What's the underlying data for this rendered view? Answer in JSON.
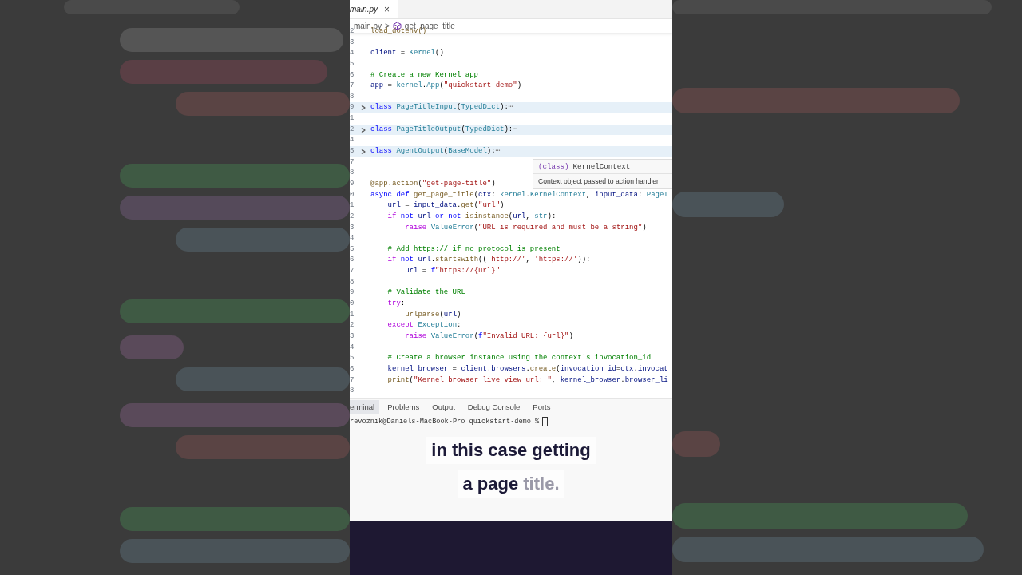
{
  "editor_tab": {
    "label": "main.py",
    "selected": true,
    "close": "×"
  },
  "breadcrumb": {
    "file": "main.py",
    "separator": ">",
    "symbol": "get_page_title"
  },
  "lines": [
    {
      "number": "2",
      "collapsed": false,
      "tokens": [
        {
          "text": "load_dotenv()",
          "kind": "fn"
        }
      ]
    },
    {
      "number": "3",
      "collapsed": false
    },
    {
      "number": "4",
      "collapsed": false,
      "tokens": [
        {
          "text": "client",
          "kind": "var"
        },
        {
          "text": " = ",
          "kind": "plain"
        },
        {
          "text": "Kernel",
          "kind": "cls"
        },
        {
          "text": "()",
          "kind": "plain"
        }
      ]
    },
    {
      "number": "5",
      "collapsed": false
    },
    {
      "number": "6",
      "collapsed": false,
      "tokens": [
        {
          "text": "# Create a new Kernel app",
          "kind": "com"
        }
      ]
    },
    {
      "number": "7",
      "collapsed": false,
      "tokens": [
        {
          "text": "app",
          "kind": "var"
        },
        {
          "text": " = ",
          "kind": "plain"
        },
        {
          "text": "kernel",
          "kind": "cls"
        },
        {
          "text": ".",
          "kind": "plain"
        },
        {
          "text": "App",
          "kind": "cls"
        },
        {
          "text": "(",
          "kind": "plain"
        },
        {
          "text": "\"quickstart-demo\"",
          "kind": "str"
        },
        {
          "text": ")",
          "kind": "plain"
        }
      ]
    },
    {
      "number": "8",
      "collapsed": false
    },
    {
      "number": "9",
      "collapsed": true,
      "tokens": [
        {
          "text": "class ",
          "kind": "kw"
        },
        {
          "text": "PageTitleInput",
          "kind": "cls"
        },
        {
          "text": "(",
          "kind": "plain"
        },
        {
          "text": "TypedDict",
          "kind": "cls"
        },
        {
          "text": "):",
          "kind": "plain"
        },
        {
          "text": "⋯",
          "kind": "fold"
        }
      ]
    },
    {
      "number": "1",
      "collapsed": false
    },
    {
      "number": "2",
      "collapsed": true,
      "tokens": [
        {
          "text": "class ",
          "kind": "kw"
        },
        {
          "text": "PageTitleOutput",
          "kind": "cls"
        },
        {
          "text": "(",
          "kind": "plain"
        },
        {
          "text": "TypedDict",
          "kind": "cls"
        },
        {
          "text": "):",
          "kind": "plain"
        },
        {
          "text": "⋯",
          "kind": "fold"
        }
      ]
    },
    {
      "number": "4",
      "collapsed": false
    },
    {
      "number": "5",
      "collapsed": true,
      "tokens": [
        {
          "text": "class ",
          "kind": "kw"
        },
        {
          "text": "AgentOutput",
          "kind": "cls"
        },
        {
          "text": "(",
          "kind": "plain"
        },
        {
          "text": "BaseModel",
          "kind": "cls"
        },
        {
          "text": "):",
          "kind": "plain"
        },
        {
          "text": "⋯",
          "kind": "fold"
        }
      ]
    },
    {
      "number": "7",
      "collapsed": false
    },
    {
      "number": "8",
      "collapsed": false
    },
    {
      "number": "9",
      "collapsed": false,
      "tokens": [
        {
          "text": "@app.action",
          "kind": "fn"
        },
        {
          "text": "(",
          "kind": "plain"
        },
        {
          "text": "\"get-page-title\"",
          "kind": "str"
        },
        {
          "text": ")",
          "kind": "plain"
        }
      ]
    },
    {
      "number": "0",
      "collapsed": false,
      "tokens": [
        {
          "text": "async def ",
          "kind": "kw"
        },
        {
          "text": "get_page_title",
          "kind": "fn"
        },
        {
          "text": "(",
          "kind": "plain"
        },
        {
          "text": "ctx",
          "kind": "var"
        },
        {
          "text": ": ",
          "kind": "plain"
        },
        {
          "text": "kernel",
          "kind": "cls"
        },
        {
          "text": ".",
          "kind": "plain"
        },
        {
          "text": "KernelContext",
          "kind": "cls"
        },
        {
          "text": ", ",
          "kind": "plain"
        },
        {
          "text": "input_data",
          "kind": "var"
        },
        {
          "text": ": ",
          "kind": "plain"
        },
        {
          "text": "PageT",
          "kind": "cls"
        }
      ]
    },
    {
      "number": "1",
      "collapsed": false,
      "tokens": [
        {
          "text": "    url",
          "kind": "var"
        },
        {
          "text": " = ",
          "kind": "plain"
        },
        {
          "text": "input_data",
          "kind": "var"
        },
        {
          "text": ".",
          "kind": "plain"
        },
        {
          "text": "get",
          "kind": "fn"
        },
        {
          "text": "(",
          "kind": "plain"
        },
        {
          "text": "\"url\"",
          "kind": "str"
        },
        {
          "text": ")",
          "kind": "plain"
        }
      ]
    },
    {
      "number": "2",
      "collapsed": false,
      "tokens": [
        {
          "text": "    if ",
          "kind": "ctrl"
        },
        {
          "text": "not ",
          "kind": "kw"
        },
        {
          "text": "url ",
          "kind": "var"
        },
        {
          "text": "or not ",
          "kind": "kw"
        },
        {
          "text": "isinstance",
          "kind": "fn"
        },
        {
          "text": "(",
          "kind": "plain"
        },
        {
          "text": "url",
          "kind": "var"
        },
        {
          "text": ", ",
          "kind": "plain"
        },
        {
          "text": "str",
          "kind": "cls"
        },
        {
          "text": "):",
          "kind": "plain"
        }
      ]
    },
    {
      "number": "3",
      "collapsed": false,
      "tokens": [
        {
          "text": "        raise ",
          "kind": "ctrl"
        },
        {
          "text": "ValueError",
          "kind": "cls"
        },
        {
          "text": "(",
          "kind": "plain"
        },
        {
          "text": "\"URL is required and must be a string\"",
          "kind": "str"
        },
        {
          "text": ")",
          "kind": "plain"
        }
      ]
    },
    {
      "number": "4",
      "collapsed": false
    },
    {
      "number": "5",
      "collapsed": false,
      "tokens": [
        {
          "text": "    # Add https:// if no protocol is present",
          "kind": "com"
        }
      ]
    },
    {
      "number": "6",
      "collapsed": false,
      "tokens": [
        {
          "text": "    if ",
          "kind": "ctrl"
        },
        {
          "text": "not ",
          "kind": "kw"
        },
        {
          "text": "url",
          "kind": "var"
        },
        {
          "text": ".",
          "kind": "plain"
        },
        {
          "text": "startswith",
          "kind": "fn"
        },
        {
          "text": "((",
          "kind": "plain"
        },
        {
          "text": "'http://'",
          "kind": "str"
        },
        {
          "text": ", ",
          "kind": "plain"
        },
        {
          "text": "'https://'",
          "kind": "str"
        },
        {
          "text": ")):",
          "kind": "plain"
        }
      ]
    },
    {
      "number": "7",
      "collapsed": false,
      "tokens": [
        {
          "text": "        url",
          "kind": "var"
        },
        {
          "text": " = ",
          "kind": "plain"
        },
        {
          "text": "f",
          "kind": "kw"
        },
        {
          "text": "\"https://{url}\"",
          "kind": "str"
        }
      ]
    },
    {
      "number": "8",
      "collapsed": false
    },
    {
      "number": "9",
      "collapsed": false,
      "tokens": [
        {
          "text": "    # Validate the URL",
          "kind": "com"
        }
      ]
    },
    {
      "number": "0",
      "collapsed": false,
      "tokens": [
        {
          "text": "    try",
          "kind": "ctrl"
        },
        {
          "text": ":",
          "kind": "plain"
        }
      ]
    },
    {
      "number": "1",
      "collapsed": false,
      "tokens": [
        {
          "text": "        urlparse",
          "kind": "fn"
        },
        {
          "text": "(",
          "kind": "plain"
        },
        {
          "text": "url",
          "kind": "var"
        },
        {
          "text": ")",
          "kind": "plain"
        }
      ]
    },
    {
      "number": "2",
      "collapsed": false,
      "tokens": [
        {
          "text": "    except ",
          "kind": "ctrl"
        },
        {
          "text": "Exception",
          "kind": "cls"
        },
        {
          "text": ":",
          "kind": "plain"
        }
      ]
    },
    {
      "number": "3",
      "collapsed": false,
      "tokens": [
        {
          "text": "        raise ",
          "kind": "ctrl"
        },
        {
          "text": "ValueError",
          "kind": "cls"
        },
        {
          "text": "(",
          "kind": "plain"
        },
        {
          "text": "f",
          "kind": "kw"
        },
        {
          "text": "\"Invalid URL: {url}\"",
          "kind": "str"
        },
        {
          "text": ")",
          "kind": "plain"
        }
      ]
    },
    {
      "number": "4",
      "collapsed": false
    },
    {
      "number": "5",
      "collapsed": false,
      "tokens": [
        {
          "text": "    # Create a browser instance using the context's invocation_id",
          "kind": "com"
        }
      ]
    },
    {
      "number": "6",
      "collapsed": false,
      "tokens": [
        {
          "text": "    kernel_browser",
          "kind": "var"
        },
        {
          "text": " = ",
          "kind": "plain"
        },
        {
          "text": "client",
          "kind": "var"
        },
        {
          "text": ".",
          "kind": "plain"
        },
        {
          "text": "browsers",
          "kind": "var"
        },
        {
          "text": ".",
          "kind": "plain"
        },
        {
          "text": "create",
          "kind": "fn"
        },
        {
          "text": "(",
          "kind": "plain"
        },
        {
          "text": "invocation_id",
          "kind": "var"
        },
        {
          "text": "=",
          "kind": "plain"
        },
        {
          "text": "ctx",
          "kind": "var"
        },
        {
          "text": ".",
          "kind": "plain"
        },
        {
          "text": "invocat",
          "kind": "var"
        }
      ]
    },
    {
      "number": "7",
      "collapsed": false,
      "tokens": [
        {
          "text": "    print",
          "kind": "fn"
        },
        {
          "text": "(",
          "kind": "plain"
        },
        {
          "text": "\"Kernel browser live view url: \"",
          "kind": "str"
        },
        {
          "text": ", ",
          "kind": "plain"
        },
        {
          "text": "kernel_browser",
          "kind": "var"
        },
        {
          "text": ".",
          "kind": "plain"
        },
        {
          "text": "browser_li",
          "kind": "var"
        }
      ]
    },
    {
      "number": "8",
      "collapsed": false
    }
  ],
  "hover_tooltip": {
    "signature_keyword": "(class)",
    "signature_name": "KernelContext",
    "description": "Context object passed to action handler"
  },
  "panel_tabs": [
    {
      "label": "erminal",
      "selected": true
    },
    {
      "label": "Problems",
      "selected": false
    },
    {
      "label": "Output",
      "selected": false
    },
    {
      "label": "Debug Console",
      "selected": false
    },
    {
      "label": "Ports",
      "selected": false
    }
  ],
  "terminal": {
    "prompt": "revoznik@Daniels-MacBook-Pro quickstart-demo %"
  },
  "caption": [
    {
      "segments": [
        {
          "text": "in this case getting",
          "spoken": true
        }
      ]
    },
    {
      "segments": [
        {
          "text": "a page ",
          "spoken": true
        },
        {
          "text": "title.",
          "spoken": false
        }
      ]
    }
  ]
}
